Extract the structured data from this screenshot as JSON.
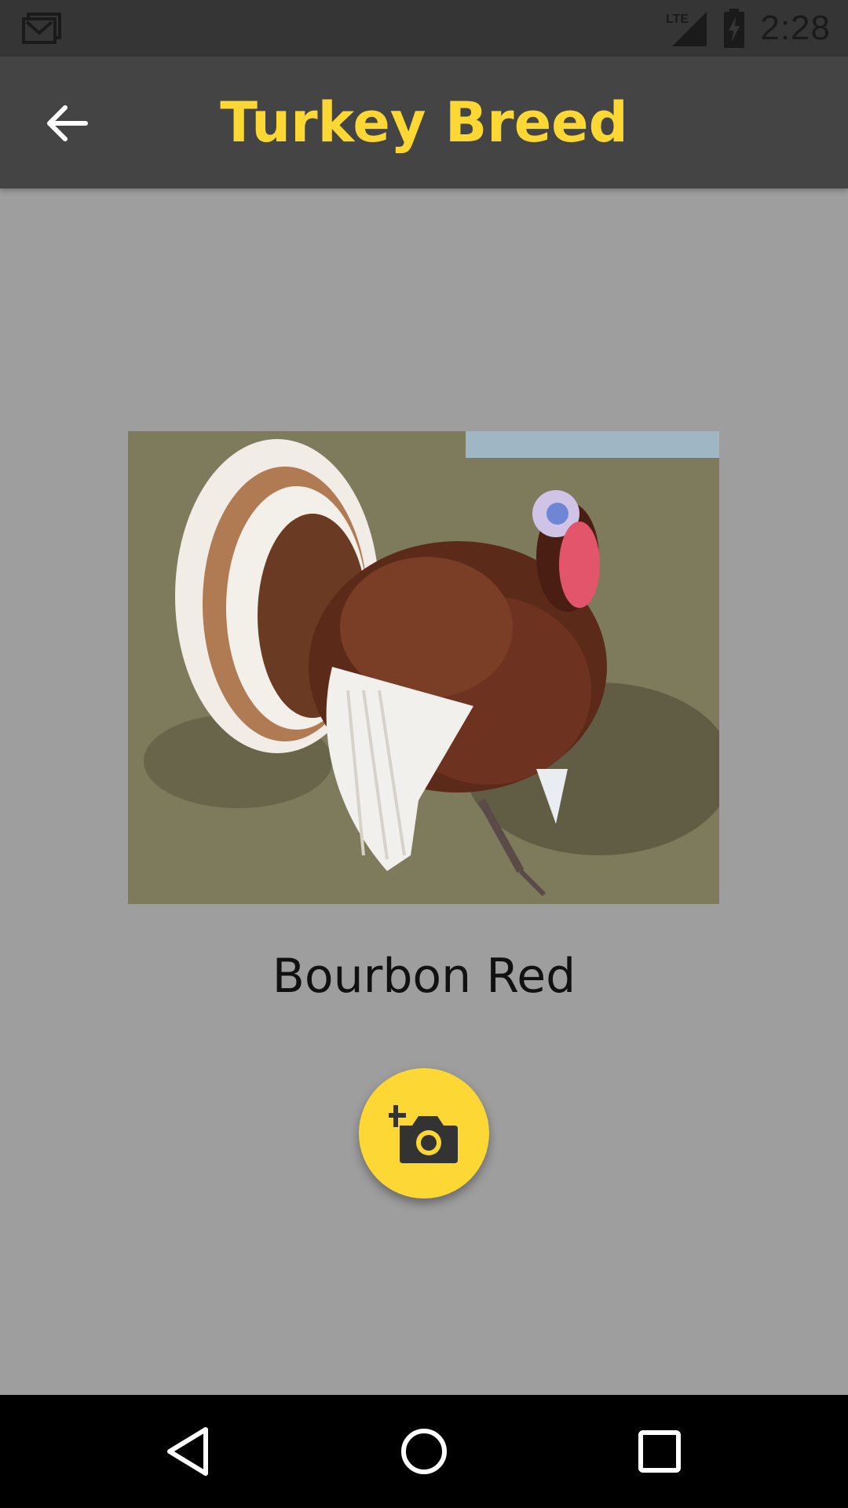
{
  "status_bar": {
    "time": "2:28",
    "network": "LTE",
    "icons": [
      "gmail-icon",
      "lte-signal-icon",
      "battery-charging-icon"
    ]
  },
  "app_bar": {
    "title": "Turkey Breed",
    "back_icon": "arrow-back-icon"
  },
  "breed": {
    "name": "Bourbon Red",
    "image": "turkey-photo"
  },
  "fab": {
    "icon": "add-a-photo-icon"
  },
  "nav_bar": {
    "buttons": [
      "back-triangle-icon",
      "home-circle-icon",
      "recents-square-icon"
    ]
  },
  "colors": {
    "accent": "#fdd835",
    "app_bar": "#444444",
    "status_bar": "#353535",
    "background": "#9e9e9e"
  }
}
